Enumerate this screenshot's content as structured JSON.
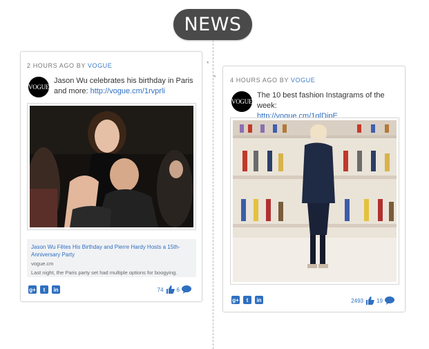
{
  "header": {
    "title": "NEWS"
  },
  "posts": [
    {
      "time_ago": "2 HOURS AGO BY",
      "author": "VOGUE",
      "logo_text": "VOGUE",
      "text": "Jason Wu celebrates his birthday in Paris and more:",
      "link": "http://vogue.cm/1rvprli",
      "preview": {
        "title": "Jason Wu Fêtes His Birthday and Pierre Hardy Hosts a 15th-Anniversary Party",
        "domain": "vogue.cm",
        "description": "Last night, the Paris party set had multiple options for boogying."
      },
      "likes": "74",
      "comments": "6"
    },
    {
      "time_ago": "4 HOURS AGO BY",
      "author": "VOGUE",
      "logo_text": "VOGUE",
      "text": "The 10 best fashion Instagrams of the week:",
      "link": "http://vogue.cm/1qlDipE",
      "likes": "2493",
      "comments": "19"
    }
  ],
  "share_buttons": [
    {
      "icon": "google-plus-icon",
      "glyph": "g+"
    },
    {
      "icon": "twitter-icon",
      "glyph": "t"
    },
    {
      "icon": "linkedin-icon",
      "glyph": "in"
    }
  ],
  "colors": {
    "accent": "#2f6fc0",
    "pill": "#4a4a4a",
    "timeline": "#b5b5b5"
  }
}
